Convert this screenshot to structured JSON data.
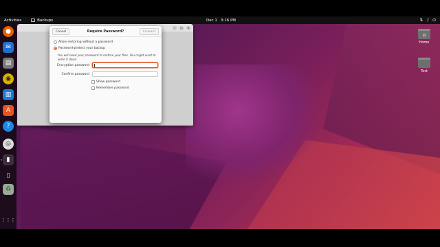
{
  "topbar": {
    "activities": "Activities",
    "app_name": "Backups",
    "date": "Dec 1",
    "time": "3:16 PM"
  },
  "dock": {
    "items": [
      {
        "name": "firefox",
        "glyph": "🦊"
      },
      {
        "name": "thunderbird",
        "glyph": "✉"
      },
      {
        "name": "files",
        "glyph": "▤"
      },
      {
        "name": "rhythmbox",
        "glyph": "◉"
      },
      {
        "name": "writer",
        "glyph": "▥"
      },
      {
        "name": "app-center",
        "glyph": "A"
      },
      {
        "name": "help",
        "glyph": "?"
      },
      {
        "name": "disc",
        "glyph": "◎"
      },
      {
        "name": "backups",
        "glyph": "▮"
      },
      {
        "name": "usb-drive",
        "glyph": "▯"
      },
      {
        "name": "trash",
        "glyph": "♻"
      },
      {
        "name": "show-apps",
        "glyph": "⋮⋮"
      }
    ]
  },
  "desktop": {
    "icons": [
      {
        "label": "Home"
      },
      {
        "label": "Test"
      }
    ]
  },
  "dialog": {
    "title": "Require Password?",
    "cancel": "Cancel",
    "forward": "Forward",
    "option_no_password": "Allow restoring without a password",
    "option_password": "Password-protect your backup",
    "note": "You will need your password to restore your files. You might want to write it down.",
    "encryption_label": "Encryption password",
    "encryption_value": "",
    "confirm_label": "Confirm password",
    "confirm_value": "",
    "show_password": "Show password",
    "remember_password": "Remember password"
  },
  "colors": {
    "accent": "#e95420",
    "topbar": "#111111",
    "dock": "#1a0e1a"
  }
}
